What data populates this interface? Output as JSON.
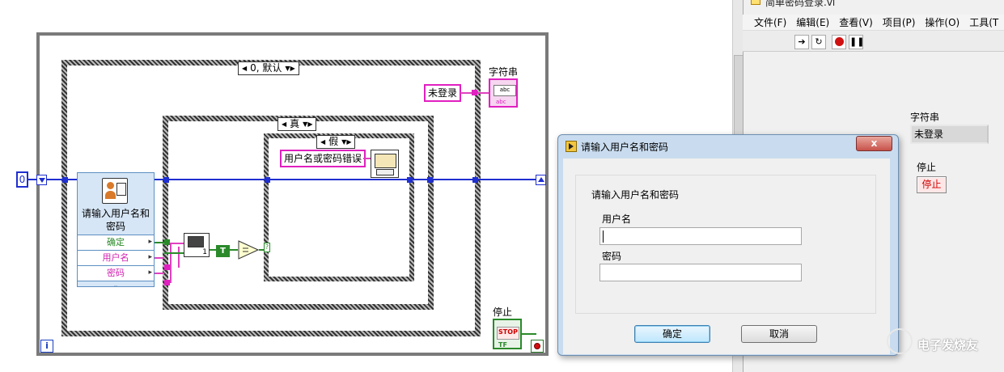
{
  "block_diagram": {
    "numeric_constant": "0",
    "iteration_terminal": "i",
    "case_outer_selector": "0, 默认",
    "case_middle_selector": "真",
    "case_inner_selector": "假",
    "express_vi": {
      "title": "请输入用户名和密码",
      "outputs": [
        "确定",
        "用户名",
        "密码"
      ]
    },
    "string_constant_logged_out": "未登录",
    "string_constant_error": "用户名或密码错误",
    "string_indicator_label": "字符串",
    "string_indicator_glyph": "abc",
    "boolean_constant": "T",
    "stop_label": "停止",
    "stop_glyph": "STOP",
    "stop_tf": "TF",
    "compare_index": "1"
  },
  "front_panel": {
    "window_title": "简单密码登录.vi",
    "menu": [
      "文件(F)",
      "编辑(E)",
      "查看(V)",
      "项目(P)",
      "操作(O)",
      "工具(T"
    ],
    "string_label": "字符串",
    "string_value": "未登录",
    "stop_label": "停止",
    "stop_button": "停止"
  },
  "dialog": {
    "title": "请输入用户名和密码",
    "close_glyph": "x",
    "prompt": "请输入用户名和密码",
    "username_label": "用户名",
    "username_value": "",
    "password_label": "密码",
    "password_value": "",
    "ok_button": "确定",
    "cancel_button": "取消"
  },
  "watermark": "电子发烧友",
  "colors": {
    "wire_numeric": "#1f2fd0",
    "wire_string": "#e040c0",
    "wire_boolean": "#2a8a2a"
  }
}
